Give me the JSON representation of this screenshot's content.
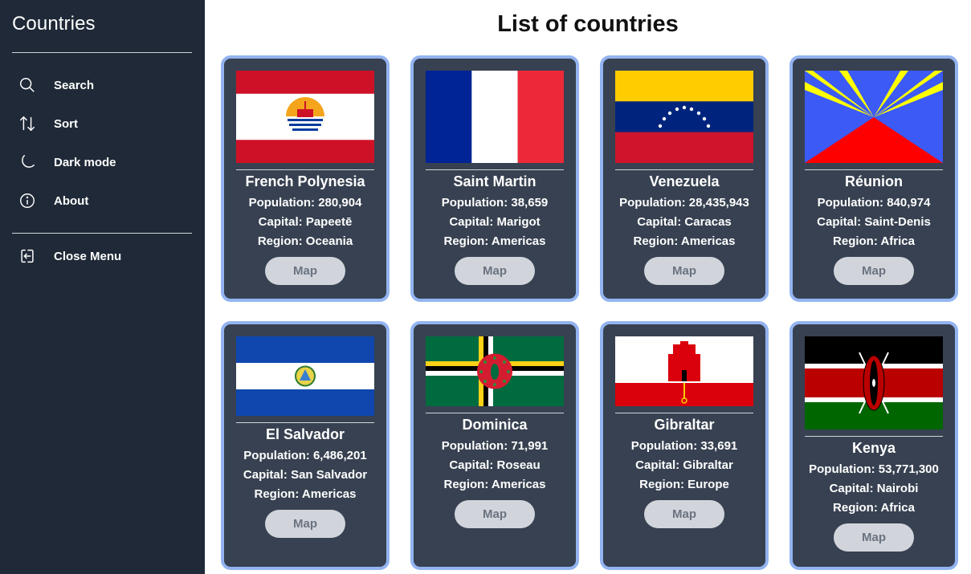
{
  "sidebar": {
    "title": "Countries",
    "items": [
      {
        "label": "Search",
        "icon": "search-icon"
      },
      {
        "label": "Sort",
        "icon": "sort-icon"
      },
      {
        "label": "Dark mode",
        "icon": "moon-icon"
      },
      {
        "label": "About",
        "icon": "info-icon"
      },
      {
        "label": "Close Menu",
        "icon": "logout-icon"
      }
    ]
  },
  "main": {
    "title": "List of countries",
    "cards": [
      {
        "name": "French Polynesia",
        "population": "Population: 280,904",
        "capital": "Capital: Papeetē",
        "region": "Region: Oceania",
        "map_label": "Map",
        "flag": "french-polynesia-flag"
      },
      {
        "name": "Saint Martin",
        "population": "Population: 38,659",
        "capital": "Capital: Marigot",
        "region": "Region: Americas",
        "map_label": "Map",
        "flag": "saint-martin-flag"
      },
      {
        "name": "Venezuela",
        "population": "Population: 28,435,943",
        "capital": "Capital: Caracas",
        "region": "Region: Americas",
        "map_label": "Map",
        "flag": "venezuela-flag"
      },
      {
        "name": "Réunion",
        "population": "Population: 840,974",
        "capital": "Capital: Saint-Denis",
        "region": "Region: Africa",
        "map_label": "Map",
        "flag": "reunion-flag"
      },
      {
        "name": "El Salvador",
        "population": "Population: 6,486,201",
        "capital": "Capital: San Salvador",
        "region": "Region: Americas",
        "map_label": "Map",
        "flag": "el-salvador-flag"
      },
      {
        "name": "Dominica",
        "population": "Population: 71,991",
        "capital": "Capital: Roseau",
        "region": "Region: Americas",
        "map_label": "Map",
        "flag": "dominica-flag"
      },
      {
        "name": "Gibraltar",
        "population": "Population: 33,691",
        "capital": "Capital: Gibraltar",
        "region": "Region: Europe",
        "map_label": "Map",
        "flag": "gibraltar-flag"
      },
      {
        "name": "Kenya",
        "population": "Population: 53,771,300",
        "capital": "Capital: Nairobi",
        "region": "Region: Africa",
        "map_label": "Map",
        "flag": "kenya-flag"
      }
    ]
  },
  "colors": {
    "sidebar_bg": "#1f2937",
    "card_bg": "#374151",
    "card_border": "#93b4f0",
    "button_bg": "#d1d5db",
    "button_text": "#6b7280"
  }
}
